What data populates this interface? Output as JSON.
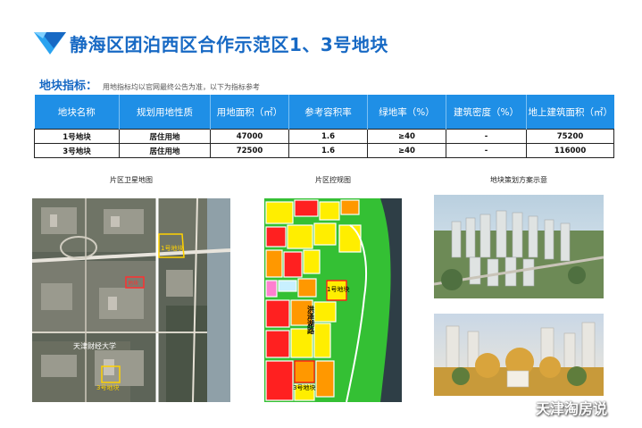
{
  "title": "静海区团泊西区合作示范区1、3号地块",
  "subtitle": {
    "label": "地块指标",
    "note": "用地指标均以官网最终公告为准，以下为指标参考"
  },
  "table": {
    "headers": [
      "地块名称",
      "规划用地性质",
      "用地面积（㎡）",
      "参考容积率",
      "绿地率（%）",
      "建筑密度（%）",
      "地上建筑面积（㎡）"
    ],
    "rows": [
      [
        "1号地块",
        "居住用地",
        "47000",
        "1.6",
        "≥40",
        "-",
        "75200"
      ],
      [
        "3号地块",
        "居住用地",
        "72500",
        "1.6",
        "≥40",
        "-",
        "116000"
      ]
    ]
  },
  "captions": {
    "satellite": "片区卫星地图",
    "control": "片区控规图",
    "plan": "地块策划方案示意"
  },
  "satellite_labels": {
    "lot1": "1号地块",
    "lot3": "3号地块",
    "uni": "天津财经大学",
    "small": "地块"
  },
  "control_labels": {
    "road": "洪泽湖路",
    "lot1": "1号地块",
    "lot3": "3号地块"
  },
  "watermark": "天津淘房说",
  "colors": {
    "brand_blue": "#1769c4",
    "header_blue": "#1f8fe6"
  },
  "icons": {
    "title_logo": "blue-triangle-logo-icon"
  }
}
